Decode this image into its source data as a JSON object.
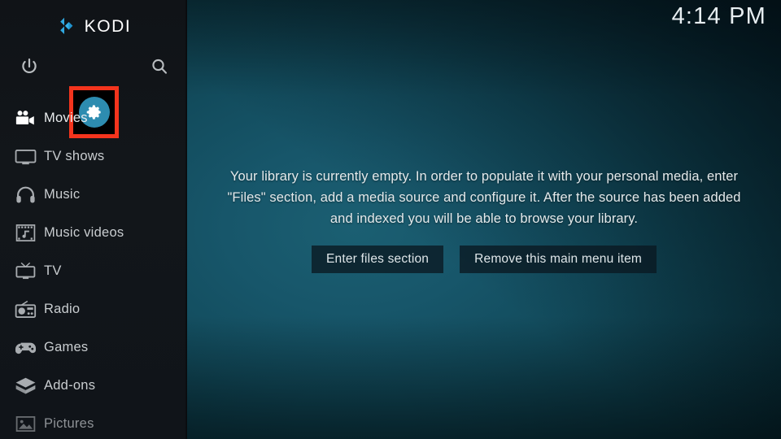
{
  "app": {
    "logo_text": "KODI",
    "logo_icon": "kodi-diamond-logo"
  },
  "clock": {
    "time": "4:14 PM"
  },
  "sidebar": {
    "top_actions": [
      {
        "name": "power",
        "icon": "power-icon",
        "label": "Power"
      },
      {
        "name": "settings",
        "icon": "gear-icon",
        "label": "Settings",
        "highlighted": true
      },
      {
        "name": "search",
        "icon": "search-icon",
        "label": "Search"
      }
    ],
    "highlight_color": "#f4341d",
    "settings_circle_color": "#2d8cb0",
    "items": [
      {
        "label": "Movies",
        "icon": "movie-camera-icon"
      },
      {
        "label": "TV shows",
        "icon": "monitor-icon"
      },
      {
        "label": "Music",
        "icon": "headphones-icon"
      },
      {
        "label": "Music videos",
        "icon": "film-music-icon"
      },
      {
        "label": "TV",
        "icon": "television-icon"
      },
      {
        "label": "Radio",
        "icon": "radio-icon"
      },
      {
        "label": "Games",
        "icon": "gamepad-icon"
      },
      {
        "label": "Add-ons",
        "icon": "addon-box-icon"
      },
      {
        "label": "Pictures",
        "icon": "picture-icon"
      }
    ]
  },
  "main": {
    "empty_message": "Your library is currently empty. In order to populate it with your personal media, enter \"Files\" section, add a media source and configure it. After the source has been added and indexed you will be able to browse your library.",
    "buttons": [
      {
        "label": "Enter files section"
      },
      {
        "label": "Remove this main menu item"
      }
    ]
  }
}
